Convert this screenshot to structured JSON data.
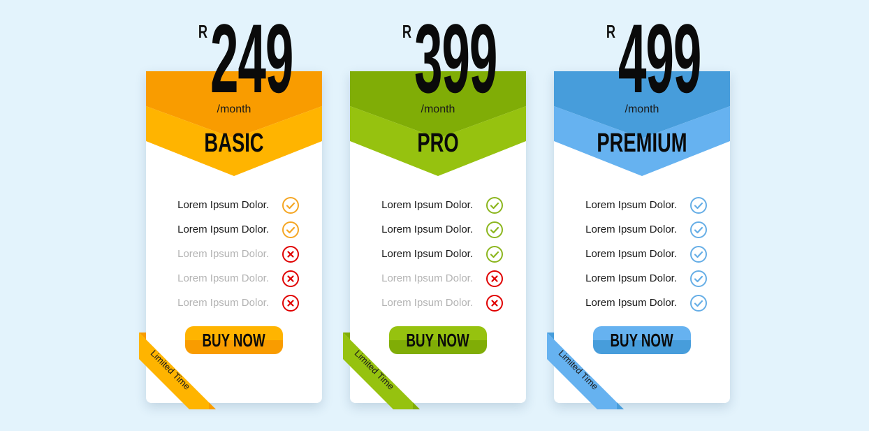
{
  "plans": [
    {
      "currency": "R",
      "amount": "249",
      "period": "/month",
      "name": "BASIC",
      "features": [
        {
          "text": "Lorem Ipsum Dolor.",
          "included": true
        },
        {
          "text": "Lorem Ipsum Dolor.",
          "included": true
        },
        {
          "text": "Lorem Ipsum Dolor.",
          "included": false
        },
        {
          "text": "Lorem Ipsum Dolor.",
          "included": false
        },
        {
          "text": "Lorem Ipsum Dolor.",
          "included": false
        }
      ],
      "button_label": "BUY NOW",
      "ribbon_label": "Limited Time",
      "colors": {
        "dark": "#f99c00",
        "light": "#ffb400",
        "check": "#f5a623",
        "cross": "#e00000"
      }
    },
    {
      "currency": "R",
      "amount": "399",
      "period": "/month",
      "name": "PRO",
      "features": [
        {
          "text": "Lorem Ipsum Dolor.",
          "included": true
        },
        {
          "text": "Lorem Ipsum Dolor.",
          "included": true
        },
        {
          "text": "Lorem Ipsum Dolor.",
          "included": true
        },
        {
          "text": "Lorem Ipsum Dolor.",
          "included": false
        },
        {
          "text": "Lorem Ipsum Dolor.",
          "included": false
        }
      ],
      "button_label": "BUY NOW",
      "ribbon_label": "Limited Time",
      "colors": {
        "dark": "#80ad06",
        "light": "#96c20f",
        "check": "#8cb61e",
        "cross": "#e00000"
      }
    },
    {
      "currency": "R",
      "amount": "499",
      "period": "/month",
      "name": "PREMIUM",
      "features": [
        {
          "text": "Lorem Ipsum Dolor.",
          "included": true
        },
        {
          "text": "Lorem Ipsum Dolor.",
          "included": true
        },
        {
          "text": "Lorem Ipsum Dolor.",
          "included": true
        },
        {
          "text": "Lorem Ipsum Dolor.",
          "included": true
        },
        {
          "text": "Lorem Ipsum Dolor.",
          "included": true
        }
      ],
      "button_label": "BUY NOW",
      "ribbon_label": "Limited Time",
      "colors": {
        "dark": "#479ddb",
        "light": "#66b2f0",
        "check": "#66aee6",
        "cross": "#e00000"
      }
    }
  ]
}
